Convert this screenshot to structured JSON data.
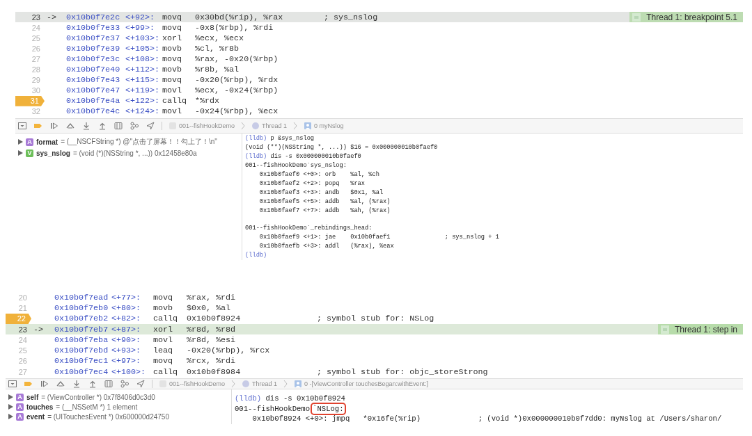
{
  "panels": [
    {
      "thread_label": "Thread 1: breakpoint 5.1",
      "code_lines": [
        {
          "number": "23",
          "arrow": "->",
          "address": "0x10b0f7e2c",
          "offset": "<+92>:",
          "mnemonic": "movq",
          "operands": "0x30bd(%rip), %rax",
          "comment": "; sys_nslog",
          "breakpoint": false,
          "current": true
        },
        {
          "number": "24",
          "address": "0x10b0f7e33",
          "offset": "<+99>:",
          "mnemonic": "movq",
          "operands": "-0x8(%rbp), %rdi",
          "breakpoint": false,
          "current": false
        },
        {
          "number": "25",
          "address": "0x10b0f7e37",
          "offset": "<+103>:",
          "mnemonic": "xorl",
          "operands": "%ecx, %ecx",
          "breakpoint": false,
          "current": false
        },
        {
          "number": "26",
          "address": "0x10b0f7e39",
          "offset": "<+105>:",
          "mnemonic": "movb",
          "operands": "%cl, %r8b",
          "breakpoint": false,
          "current": false
        },
        {
          "number": "27",
          "address": "0x10b0f7e3c",
          "offset": "<+108>:",
          "mnemonic": "movq",
          "operands": "%rax, -0x20(%rbp)",
          "breakpoint": false,
          "current": false
        },
        {
          "number": "28",
          "address": "0x10b0f7e40",
          "offset": "<+112>:",
          "mnemonic": "movb",
          "operands": "%r8b, %al",
          "breakpoint": false,
          "current": false
        },
        {
          "number": "29",
          "address": "0x10b0f7e43",
          "offset": "<+115>:",
          "mnemonic": "movq",
          "operands": "-0x20(%rbp), %rdx",
          "breakpoint": false,
          "current": false
        },
        {
          "number": "30",
          "address": "0x10b0f7e47",
          "offset": "<+119>:",
          "mnemonic": "movl",
          "operands": "%ecx, -0x24(%rbp)",
          "breakpoint": false,
          "current": false
        },
        {
          "number": "31",
          "address": "0x10b0f7e4a",
          "offset": "<+122>:",
          "mnemonic": "callq",
          "operands": "*%rdx",
          "breakpoint": true,
          "current": false
        },
        {
          "number": "32",
          "address": "0x10b0f7e4c",
          "offset": "<+124>:",
          "mnemonic": "movl",
          "operands": "-0x24(%rbp), %ecx",
          "breakpoint": false,
          "current": false
        }
      ],
      "breadcrumbs": [
        {
          "kind": "app",
          "label": "001--fishHookDemo"
        },
        {
          "kind": "thread",
          "label": "Thread 1"
        },
        {
          "kind": "frame",
          "label": "0 myNslog"
        }
      ],
      "variables": [
        {
          "kind": "argument",
          "badge": "A",
          "name": "format",
          "value": "= (__NSCFString *) @\"点击了屏幕！！勾上了！\\n\""
        },
        {
          "kind": "variable",
          "badge": "V",
          "name": "sys_nslog",
          "value": "= (void (*)(NSString *, ...)) 0x12458e80a"
        }
      ],
      "console": [
        {
          "prompt": "(lldb)",
          "text": "p &sys_nslog"
        },
        {
          "text": "(void (**)(NSString *, ...)) $16 = 0x000000010b0faef0"
        },
        {
          "prompt": "(lldb)",
          "text": "dis -s 0x000000010b0faef0"
        },
        {
          "text": "001--fishHookDemo`sys_nslog:"
        },
        {
          "text": "    0x10b0faef0 <+0>: orb    %al, %ch"
        },
        {
          "text": "    0x10b0faef2 <+2>: popq   %rax"
        },
        {
          "text": "    0x10b0faef3 <+3>: andb   $0x1, %al"
        },
        {
          "text": "    0x10b0faef5 <+5>: addb   %al, (%rax)"
        },
        {
          "text": "    0x10b0faef7 <+7>: addb   %ah, (%rax)"
        },
        {
          "kind": "blank"
        },
        {
          "text": "001--fishHookDemo`_rebindings_head:"
        },
        {
          "text": "    0x10b0faef9 <+1>: jae    0x10b0faef1               ; sys_nslog + 1"
        },
        {
          "text": "    0x10b0faefb <+3>: addl   (%rax), %eax"
        },
        {
          "prompt": "(lldb)"
        }
      ]
    },
    {
      "thread_label": "Thread 1: step in",
      "code_lines": [
        {
          "number": "20",
          "address": "0x10b0f7ead",
          "offset": "<+77>:",
          "mnemonic": "movq",
          "operands": "%rax, %rdi",
          "breakpoint": false,
          "current": false
        },
        {
          "number": "21",
          "address": "0x10b0f7eb0",
          "offset": "<+80>:",
          "mnemonic": "movb",
          "operands": "$0x0, %al",
          "breakpoint": false,
          "current": false
        },
        {
          "number": "22",
          "address": "0x10b0f7eb2",
          "offset": "<+82>:",
          "mnemonic": "callq",
          "operands": "0x10b0f8924",
          "comment": "; symbol stub for: NSLog",
          "breakpoint": true,
          "current": false
        },
        {
          "number": "23",
          "arrow": "->",
          "address": "0x10b0f7eb7",
          "offset": "<+87>:",
          "mnemonic": "xorl",
          "operands": "%r8d, %r8d",
          "breakpoint": false,
          "current": true
        },
        {
          "number": "24",
          "address": "0x10b0f7eba",
          "offset": "<+90>:",
          "mnemonic": "movl",
          "operands": "%r8d, %esi",
          "breakpoint": false,
          "current": false
        },
        {
          "number": "25",
          "address": "0x10b0f7ebd",
          "offset": "<+93>:",
          "mnemonic": "leaq",
          "operands": "-0x20(%rbp), %rcx",
          "breakpoint": false,
          "current": false
        },
        {
          "number": "26",
          "address": "0x10b0f7ec1",
          "offset": "<+97>:",
          "mnemonic": "movq",
          "operands": "%rcx, %rdi",
          "breakpoint": false,
          "current": false
        },
        {
          "number": "27",
          "address": "0x10b0f7ec4",
          "offset": "<+100>:",
          "mnemonic": "callq",
          "operands": "0x10b0f8984",
          "comment": "; symbol stub for: objc_storeStrong",
          "breakpoint": false,
          "current": false
        }
      ],
      "breadcrumbs": [
        {
          "kind": "app",
          "label": "001--fishHookDemo"
        },
        {
          "kind": "thread",
          "label": "Thread 1"
        },
        {
          "kind": "frame",
          "label": "0 -[ViewController touchesBegan:withEvent:]"
        }
      ],
      "variables": [
        {
          "kind": "argument",
          "badge": "A",
          "name": "self",
          "value": "= (ViewController *) 0x7f8406d0c3d0"
        },
        {
          "kind": "argument",
          "badge": "A",
          "name": "touches",
          "value": "= (__NSSetM *) 1 element"
        },
        {
          "kind": "argument",
          "badge": "A",
          "name": "event",
          "value": "= (UITouchesEvent *) 0x600000d24750"
        }
      ],
      "console": [
        {
          "prompt": "(lldb)",
          "text": "dis -s 0x10b0f8924"
        },
        {
          "text": "001--fishHookDemo",
          "boxed": "`NSLog:"
        },
        {
          "text": "    0x10b0f8924 <+0>: jmpq   *0x16fe(%rip)             ; (void *)0x000000010b0f7dd0: myNslog at /Users/sharon/"
        }
      ]
    }
  ]
}
